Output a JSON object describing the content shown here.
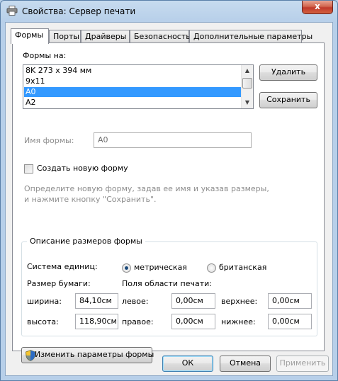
{
  "window": {
    "title": "Свойства: Сервер печати",
    "close_glyph": "x"
  },
  "tabs": [
    "Формы",
    "Порты",
    "Драйверы",
    "Безопасность",
    "Дополнительные параметры"
  ],
  "forms_label": "Формы на:",
  "forms_list": [
    "8K 273 x 394 мм",
    "9x11",
    "A0",
    "A2"
  ],
  "selected_form": "A0",
  "buttons": {
    "delete": "Удалить",
    "save": "Сохранить",
    "change_params": "Изменить параметры формы",
    "ok": "ОК",
    "cancel": "Отмена",
    "apply": "Применить"
  },
  "form_name_label": "Имя формы:",
  "form_name_value": "A0",
  "create_new_form": "Создать новую форму",
  "hint_line1": "Определите новую форму, задав ее имя и указав размеры,",
  "hint_line2": "и нажмите кнопку \"Сохранить\".",
  "size_group": {
    "title": "Описание размеров формы",
    "units_label": "Система единиц:",
    "metric": "метрическая",
    "imperial": "британская",
    "units_selected": "метрическая",
    "paper_size_label": "Размер бумаги:",
    "margins_label": "Поля области печати:",
    "width_label": "ширина:",
    "width_value": "84,10см",
    "height_label": "высота:",
    "height_value": "118,90см",
    "left_label": "левое:",
    "left_value": "0,00см",
    "right_label": "правое:",
    "right_value": "0,00см",
    "top_label": "верхнее:",
    "top_value": "0,00см",
    "bottom_label": "нижнее:",
    "bottom_value": "0,00см"
  },
  "colors": {
    "selection": "#3399ff",
    "close": "#c0392b",
    "frame": "#b9d1ea"
  },
  "icons": [
    "printer-icon",
    "close-icon",
    "scroll-up-icon",
    "scroll-down-icon",
    "shield-icon"
  ]
}
